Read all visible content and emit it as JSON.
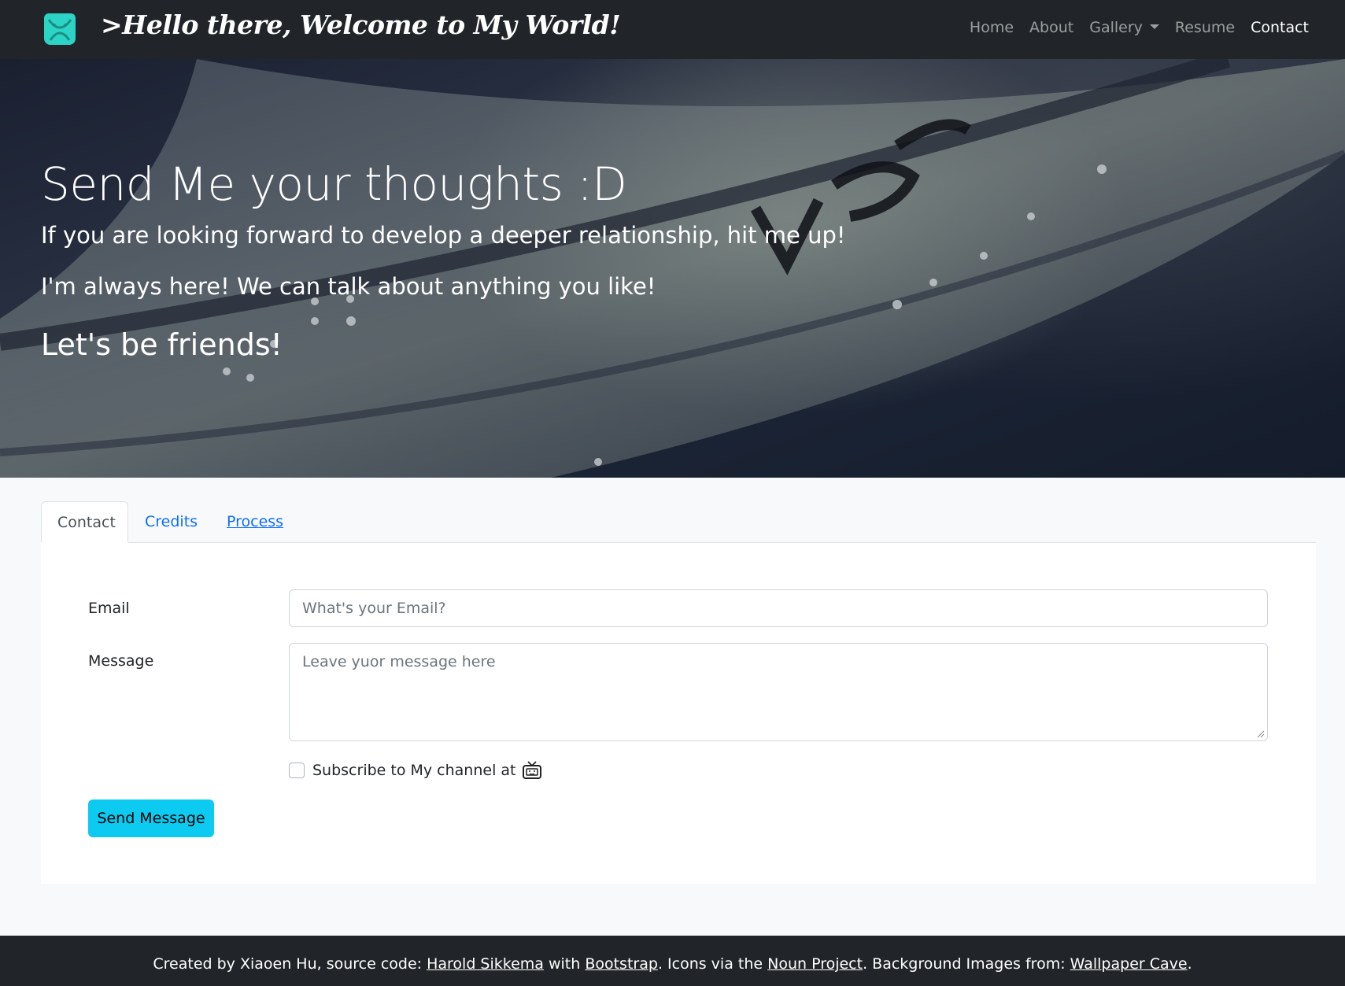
{
  "navbar": {
    "brand": ">Hello there, Welcome to My World!",
    "links": {
      "home": "Home",
      "about": "About",
      "gallery": "Gallery",
      "resume": "Resume",
      "contact": "Contact"
    },
    "logo_icon": "bear-logo-icon"
  },
  "hero": {
    "title": "Send Me your thoughts :D",
    "line1": "If you are looking forward to develop a deeper relationship, hit me up!",
    "line2": "I'm always here! We can talk about anything you like!",
    "line3": "Let's be friends!"
  },
  "tabs": {
    "contact": "Contact",
    "credits": "Credits",
    "process": "Process"
  },
  "form": {
    "email_label": "Email",
    "email_placeholder": "What's your Email?",
    "message_label": "Message",
    "message_placeholder": "Leave yuor message here",
    "subscribe_label": "Subscribe to My channel at",
    "subscribe_icon": "tv-icon",
    "send_label": "Send Message"
  },
  "footer": {
    "prefix": "Created by Xiaoen Hu, source code: ",
    "link1": "Harold Sikkema",
    "mid1": " with ",
    "link2": "Bootstrap",
    "mid2": ". Icons via the ",
    "link3": "Noun Project",
    "mid3": ". Background Images from: ",
    "link4": "Wallpaper Cave",
    "suffix": "."
  },
  "colors": {
    "navbar_bg": "#212529",
    "accent_button": "#0dcaf0",
    "link_blue": "#0d6efd",
    "logo_teal": "#2bd4c4"
  }
}
